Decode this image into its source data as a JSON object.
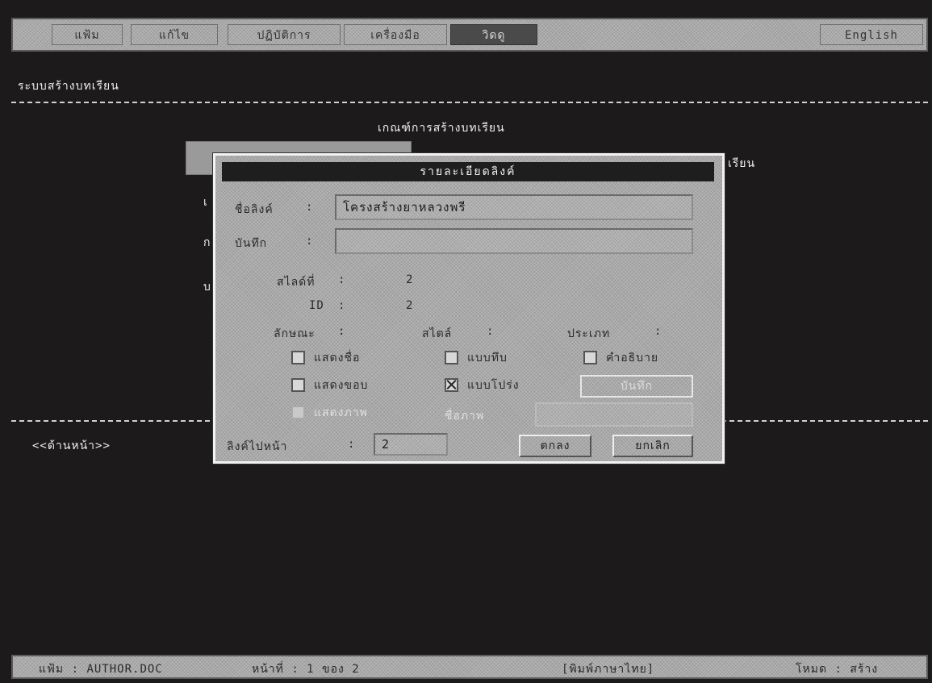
{
  "menu": {
    "items": [
      {
        "label": "แฟ้ม"
      },
      {
        "label": "แก้ไข"
      },
      {
        "label": "ปฏิบัติการ"
      },
      {
        "label": "เครื่องมือ"
      },
      {
        "label": "วิดดู"
      }
    ],
    "language_label": "English"
  },
  "screen": {
    "app_title": "ระบบสร้างบทเรียน",
    "section_heading": "เกณฑ์การสร้างบทเรียน",
    "obscured_right_text": "เรียน",
    "nav_text": "<<ด้านหน้า>>",
    "partial_left_chars": [
      "เ",
      "ก",
      "บ"
    ]
  },
  "dialog": {
    "title": "รายละเอียดลิงค์",
    "link_name_label": "ชื่อลิงค์",
    "link_name_value": "โครงสร้างยาหลวงพรี",
    "note_label": "บันทึก",
    "note_value": "",
    "slide_no_label": "สไลด์ที่",
    "slide_no_value": "2",
    "id_label": "ID",
    "id_value": "2",
    "col_headers": {
      "appearance": "ลักษณะ",
      "style": "สไตล์",
      "type": "ประเภท"
    },
    "options": {
      "show_name": {
        "label": "แสดงชื่อ",
        "checked": false
      },
      "show_border": {
        "label": "แสดงขอบ",
        "checked": false
      },
      "show_image": {
        "label": "แสดงภาพ",
        "checked": false
      },
      "solid_style": {
        "label": "แบบทึบ",
        "checked": false
      },
      "transparent_style": {
        "label": "แบบโปร่ง",
        "checked": true
      },
      "description_type": {
        "label": "คำอธิบาย",
        "checked": false
      }
    },
    "record_button": "บันทึก",
    "file_name_label": "ชื่อภาพ",
    "file_name_value": "",
    "next_link_label": "ลิงค์ไปหน้า",
    "next_link_value": "2",
    "ok_button": "ตกลง",
    "cancel_button": "ยกเลิก"
  },
  "status": {
    "file": "แฟ้ม : AUTHOR.DOC",
    "page": "หน้าที่ : 1  ของ 2",
    "hint": "[พิมพ์ภาษาไทย]",
    "mode": "โหมด : สร้าง"
  }
}
